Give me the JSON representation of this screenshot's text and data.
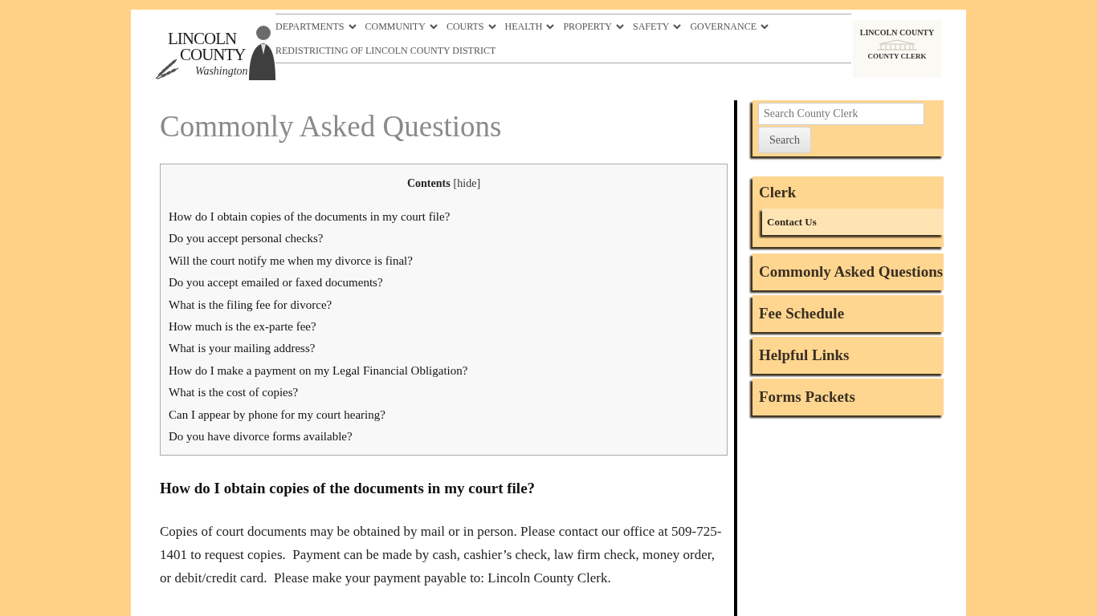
{
  "header": {
    "logo": {
      "name_line_1": "LINCOLN",
      "name_line_2": "COUNTY",
      "script": "Washington"
    },
    "nav": [
      {
        "label": "DEPARTMENTS",
        "has_submenu": true
      },
      {
        "label": "COMMUNITY",
        "has_submenu": true
      },
      {
        "label": "COURTS",
        "has_submenu": true
      },
      {
        "label": "HEALTH",
        "has_submenu": true
      },
      {
        "label": "PROPERTY",
        "has_submenu": true
      },
      {
        "label": "SAFETY",
        "has_submenu": true
      },
      {
        "label": "GOVERNANCE",
        "has_submenu": true
      },
      {
        "label": "REDISTRICTING OF LINCOLN COUNTY DISTRICT",
        "has_submenu": false
      }
    ],
    "office_logo": {
      "title": "LINCOLN COUNTY",
      "office": "COUNTY CLERK"
    }
  },
  "page_title": "Commonly Asked Questions",
  "toc": {
    "title": "Contents",
    "toggle": "[hide]",
    "items": [
      "How do I obtain copies of the documents in my court file?",
      "Do you accept personal checks?",
      "Will the court notify me when my divorce is final?",
      "Do you accept emailed or faxed documents?",
      "What is the filing fee for divorce?",
      "How much is the ex-parte fee?",
      "What is your mailing address?",
      "How do I make a payment on my Legal Financial Obligation?",
      "What is the cost of copies?",
      "Can I appear by phone for my court hearing?",
      "Do you have divorce forms available?"
    ]
  },
  "article": {
    "heading": "How do I obtain copies of the documents in my court file?",
    "paragraph": "Copies of court documents may be obtained by mail or in person. Please contact our office at 509-725-1401 to request copies.  Payment can be made by cash, cashier’s check, law firm check, money order, or debit/credit card.  Please make your payment payable to: Lincoln County Clerk."
  },
  "sidebar": {
    "search": {
      "placeholder": "Search County Clerk",
      "button": "Search"
    },
    "menu": [
      {
        "label": "Clerk",
        "children": [
          {
            "label": "Contact Us"
          }
        ]
      },
      {
        "label": "Commonly Asked Questions"
      },
      {
        "label": "Fee Schedule"
      },
      {
        "label": "Helpful Links"
      },
      {
        "label": "Forms Packets"
      }
    ]
  }
}
